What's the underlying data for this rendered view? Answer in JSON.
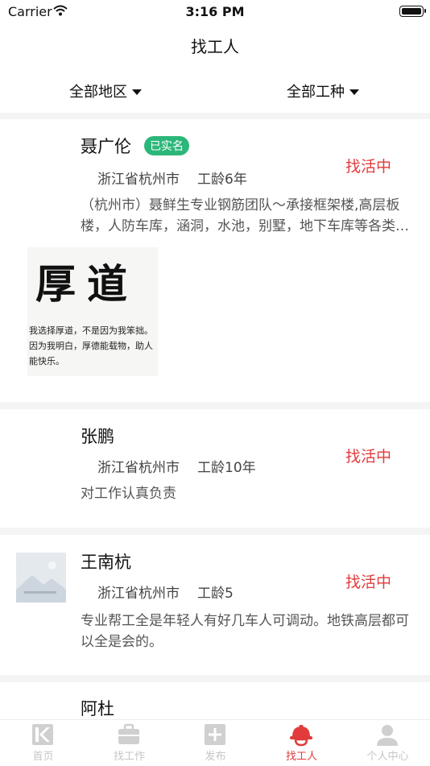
{
  "status_bar": {
    "carrier": "Carrier",
    "time": "3:16 PM"
  },
  "header": {
    "title": "找工人"
  },
  "filters": {
    "region": "全部地区",
    "trade": "全部工种"
  },
  "workers": [
    {
      "name": "聂广伦",
      "badge": "已实名",
      "location": "浙江省杭州市",
      "experience": "工龄6年",
      "status": "找活中",
      "description": "（杭州市）聂鲜生专业钢筋团队～承接框架楼,高层板楼，人防车库，涵洞，水池，别墅，地下车库等各类钢筋工程",
      "image": {
        "headline": "厚道",
        "caption": "我选择厚道，不是因为我笨拙。因为我明白，厚德能载物，助人能快乐。"
      }
    },
    {
      "name": "张鹏",
      "location": "浙江省杭州市",
      "experience": "工龄10年",
      "status": "找活中",
      "description": "对工作认真负责"
    },
    {
      "name": "王南杭",
      "location": "浙江省杭州市",
      "experience": "工龄5",
      "status": "找活中",
      "description": "专业帮工全是年轻人有好几车人可调动。地铁高层都可以全是会的。"
    },
    {
      "name": "阿杜"
    }
  ],
  "tabs": [
    {
      "label": "首页",
      "icon": "home-icon"
    },
    {
      "label": "找工作",
      "icon": "briefcase-icon"
    },
    {
      "label": "发布",
      "icon": "plus-icon"
    },
    {
      "label": "找工人",
      "icon": "hardhat-icon",
      "active": true
    },
    {
      "label": "个人中心",
      "icon": "person-icon"
    }
  ],
  "colors": {
    "accent": "#e23b3b",
    "badge": "#2cb77a",
    "inactive_tab": "#c6c6c6"
  }
}
